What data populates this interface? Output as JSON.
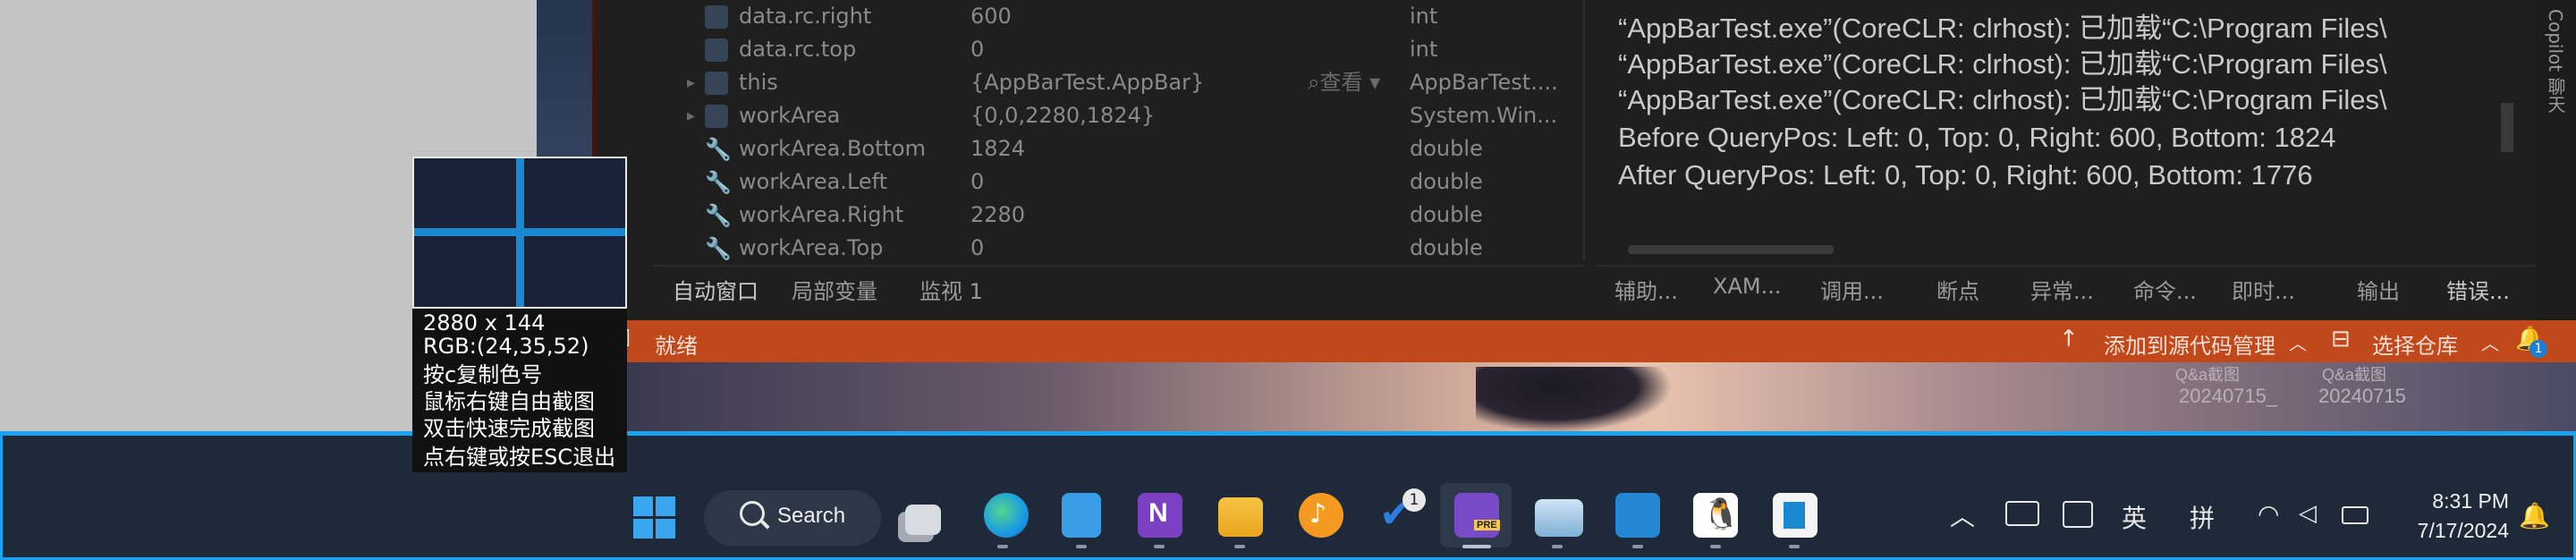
{
  "locals": {
    "rows": [
      {
        "name": "data.rc.right",
        "value": "600",
        "type": "int",
        "expander": ""
      },
      {
        "name": "data.rc.top",
        "value": "0",
        "type": "int",
        "expander": ""
      },
      {
        "name": "this",
        "value": "{AppBarTest.AppBar}",
        "type": "AppBarTest....",
        "expander": "▸",
        "search": "⌕查看 ▾"
      },
      {
        "name": "workArea",
        "value": "{0,0,2280,1824}",
        "type": "System.Win...",
        "expander": "▸"
      },
      {
        "name": "workArea.Bottom",
        "value": "1824",
        "type": "double",
        "expander": ""
      },
      {
        "name": "workArea.Left",
        "value": "0",
        "type": "double",
        "expander": ""
      },
      {
        "name": "workArea.Right",
        "value": "2280",
        "type": "double",
        "expander": ""
      },
      {
        "name": "workArea.Top",
        "value": "0",
        "type": "double",
        "expander": ""
      }
    ],
    "tabs": [
      "自动窗口",
      "局部变量",
      "监视 1"
    ]
  },
  "output": {
    "lines": [
      "“AppBarTest.exe”(CoreCLR: clrhost): 已加载“C:\\Program Files\\",
      "“AppBarTest.exe”(CoreCLR: clrhost): 已加载“C:\\Program Files\\",
      "“AppBarTest.exe”(CoreCLR: clrhost): 已加载“C:\\Program Files\\",
      "Before QueryPos: Left: 0, Top: 0, Right: 600, Bottom: 1824",
      "After QueryPos: Left: 0, Top: 0, Right: 600, Bottom: 1776"
    ],
    "tabs": [
      "辅助...",
      "XAM...",
      "调用...",
      "断点",
      "异常...",
      "命令...",
      "即时...",
      "输出",
      "错误..."
    ]
  },
  "copilot_label": "Copilot 聊天",
  "statusbar": {
    "ready": "就绪",
    "add_to_source": "添加到源代码管理",
    "select_repo": "选择仓库",
    "notif_count": "1"
  },
  "wallpaper_labels": {
    "left_a": "Q&a截图",
    "left_b": "20240715_",
    "right_a": "Q&a截图",
    "right_b": "20240715"
  },
  "picker": {
    "size": "2880 x 144",
    "rgb": "RGB:(24,35,52)",
    "hint1": "按c复制色号",
    "hint2": "鼠标右键自由截图",
    "hint3": "双击快速完成截图",
    "hint4": "点右键或按ESC退出",
    "color": "#182334"
  },
  "taskbar": {
    "search_label": "Search",
    "todo_badge": "1",
    "tray": {
      "lang1": "英",
      "lang2": "拼"
    },
    "time": "8:31 PM",
    "date": "7/17/2024",
    "accent": "#1aa3f0"
  }
}
